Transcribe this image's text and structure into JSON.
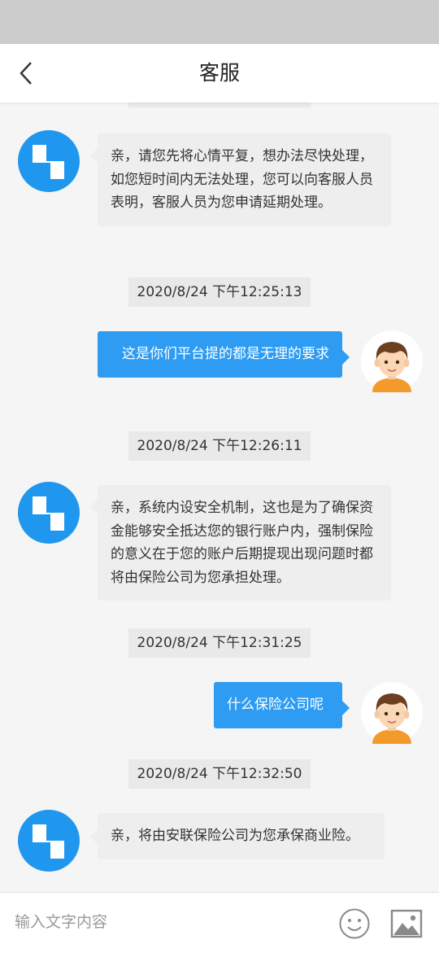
{
  "header": {
    "title": "客服"
  },
  "messages": [
    {
      "from": "bot",
      "text": "亲，请您先将心情平复，想办法尽快处理，如您短时间内无法处理，您可以向客服人员表明，客服人员为您申请延期处理。"
    },
    {
      "timestamp": "2020/8/24 下午12:25:13"
    },
    {
      "from": "user",
      "text": "这是你们平台提的都是无理的要求"
    },
    {
      "timestamp": "2020/8/24 下午12:26:11"
    },
    {
      "from": "bot",
      "text": "亲，系统内设安全机制，这也是为了确保资金能够安全抵达您的银行账户内，强制保险的意义在于您的账户后期提现出现问题时都将由保险公司为您承担处理。"
    },
    {
      "timestamp": "2020/8/24 下午12:31:25"
    },
    {
      "from": "user",
      "text": "什么保险公司呢"
    },
    {
      "timestamp": "2020/8/24 下午12:32:50"
    },
    {
      "from": "bot",
      "text": "亲，将由安联保险公司为您承保商业险。"
    }
  ],
  "input": {
    "placeholder": "输入文字内容",
    "value": ""
  },
  "colors": {
    "accent": "#2e9cf3",
    "bot_bubble": "#eeeeee",
    "user_shirt": "#f39a2b"
  },
  "icons": {
    "back": "back-arrow-icon",
    "emoji": "emoji-icon",
    "image": "image-icon"
  }
}
